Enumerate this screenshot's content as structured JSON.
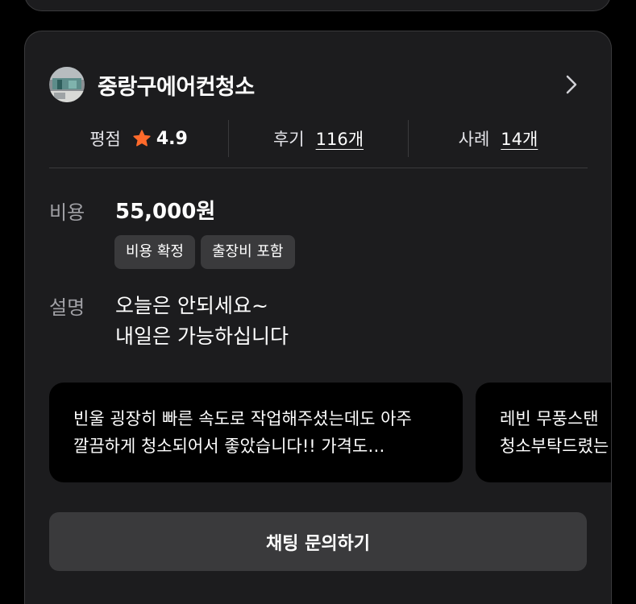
{
  "provider": {
    "name": "중랑구에어컨청소",
    "avatar_icon": "provider-photo"
  },
  "stats": {
    "rating_label": "평점",
    "rating_value": "4.9",
    "rating_icon": "star-icon",
    "rating_color": "#ff6a2b",
    "reviews_label": "후기",
    "reviews_count": "116개",
    "cases_label": "사례",
    "cases_count": "14개"
  },
  "cost": {
    "label": "비용",
    "price": "55,000원",
    "chips": [
      "비용 확정",
      "출장비 포함"
    ]
  },
  "description": {
    "label": "설명",
    "lines": [
      "오늘은 안되세요~",
      "내일은 가능하십니다"
    ]
  },
  "reviews": [
    {
      "text": "빈울 굉장히 빠른 속도로 작업해주셨는데도 아주 깔끔하게 청소되어서 좋았습니다!! 가격도 합리적이에요"
    },
    {
      "text": "레빈 무풍스탠\n청소부탁드렸는"
    }
  ],
  "chat_button": {
    "label": "채팅 문의하기"
  },
  "colors": {
    "card_bg": "#1c1c1e",
    "page_bg": "#000000",
    "chip_bg": "#3a3a3c",
    "accent_star": "#ff6a2b"
  }
}
